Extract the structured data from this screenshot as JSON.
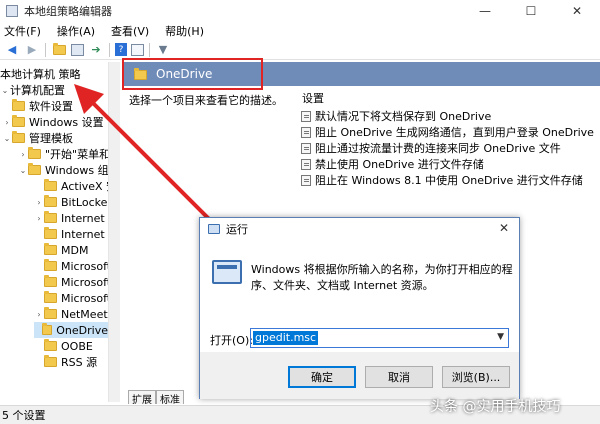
{
  "window": {
    "title": "本地组策略编辑器",
    "controls": {
      "minimize": "—",
      "maximize": "☐",
      "close": "✕"
    }
  },
  "menu": [
    "文件(F)",
    "操作(A)",
    "查看(V)",
    "帮助(H)"
  ],
  "toolbar_icons": [
    "back-icon",
    "forward-icon",
    "folder-up-icon",
    "show-hide-tree-icon",
    "export-icon",
    "help-icon",
    "properties-icon",
    "filter-icon"
  ],
  "tree": {
    "root": "本地计算机 策略",
    "items": [
      {
        "label": "计算机配置",
        "chev": "⌄"
      },
      {
        "label": "软件设置",
        "chev": ""
      },
      {
        "label": "Windows 设置",
        "chev": "›"
      },
      {
        "label": "管理模板",
        "chev": "⌄"
      },
      {
        "label": "\"开始\"菜单和任",
        "chev": "›"
      },
      {
        "label": "Windows 组件",
        "chev": "⌄"
      },
      {
        "label": "ActiveX 安",
        "chev": ""
      },
      {
        "label": "BitLocker",
        "chev": "›"
      },
      {
        "label": "Internet E",
        "chev": "›"
      },
      {
        "label": "Internet I",
        "chev": ""
      },
      {
        "label": "MDM",
        "chev": ""
      },
      {
        "label": "Microsoft",
        "chev": ""
      },
      {
        "label": "Microsoft",
        "chev": ""
      },
      {
        "label": "Microsoft",
        "chev": ""
      },
      {
        "label": "NetMeetin",
        "chev": "›"
      },
      {
        "label": "OneDrive",
        "chev": ""
      },
      {
        "label": "OOBE",
        "chev": ""
      },
      {
        "label": "RSS 源",
        "chev": ""
      }
    ]
  },
  "main": {
    "header": "OneDrive",
    "description": "选择一个项目来查看它的描述。",
    "settings_heading": "设置",
    "policies": [
      "默认情况下将文档保存到 OneDrive",
      "阻止 OneDrive 生成网络通信，直到用户登录 OneDrive",
      "阻止通过按流量计费的连接来同步 OneDrive 文件",
      "禁止使用 OneDrive 进行文件存储",
      "阻止在 Windows 8.1 中使用 OneDrive 进行文件存储"
    ],
    "tabs": [
      "扩展",
      "标准"
    ]
  },
  "status": "5 个设置",
  "run_dialog": {
    "title": "运行",
    "close": "✕",
    "text": "Windows 将根据你所输入的名称，为你打开相应的程序、文件夹、文档或 Internet 资源。",
    "open_label": "打开(O):",
    "open_value": "gpedit.msc",
    "ok": "确定",
    "cancel": "取消",
    "browse": "浏览(B)..."
  },
  "watermark": "头条 @实用手机技巧",
  "colors": {
    "header_bar": "#6f8bb8",
    "highlight": "#e02424",
    "arrow": "#e02424",
    "selection": "#0078d7"
  }
}
